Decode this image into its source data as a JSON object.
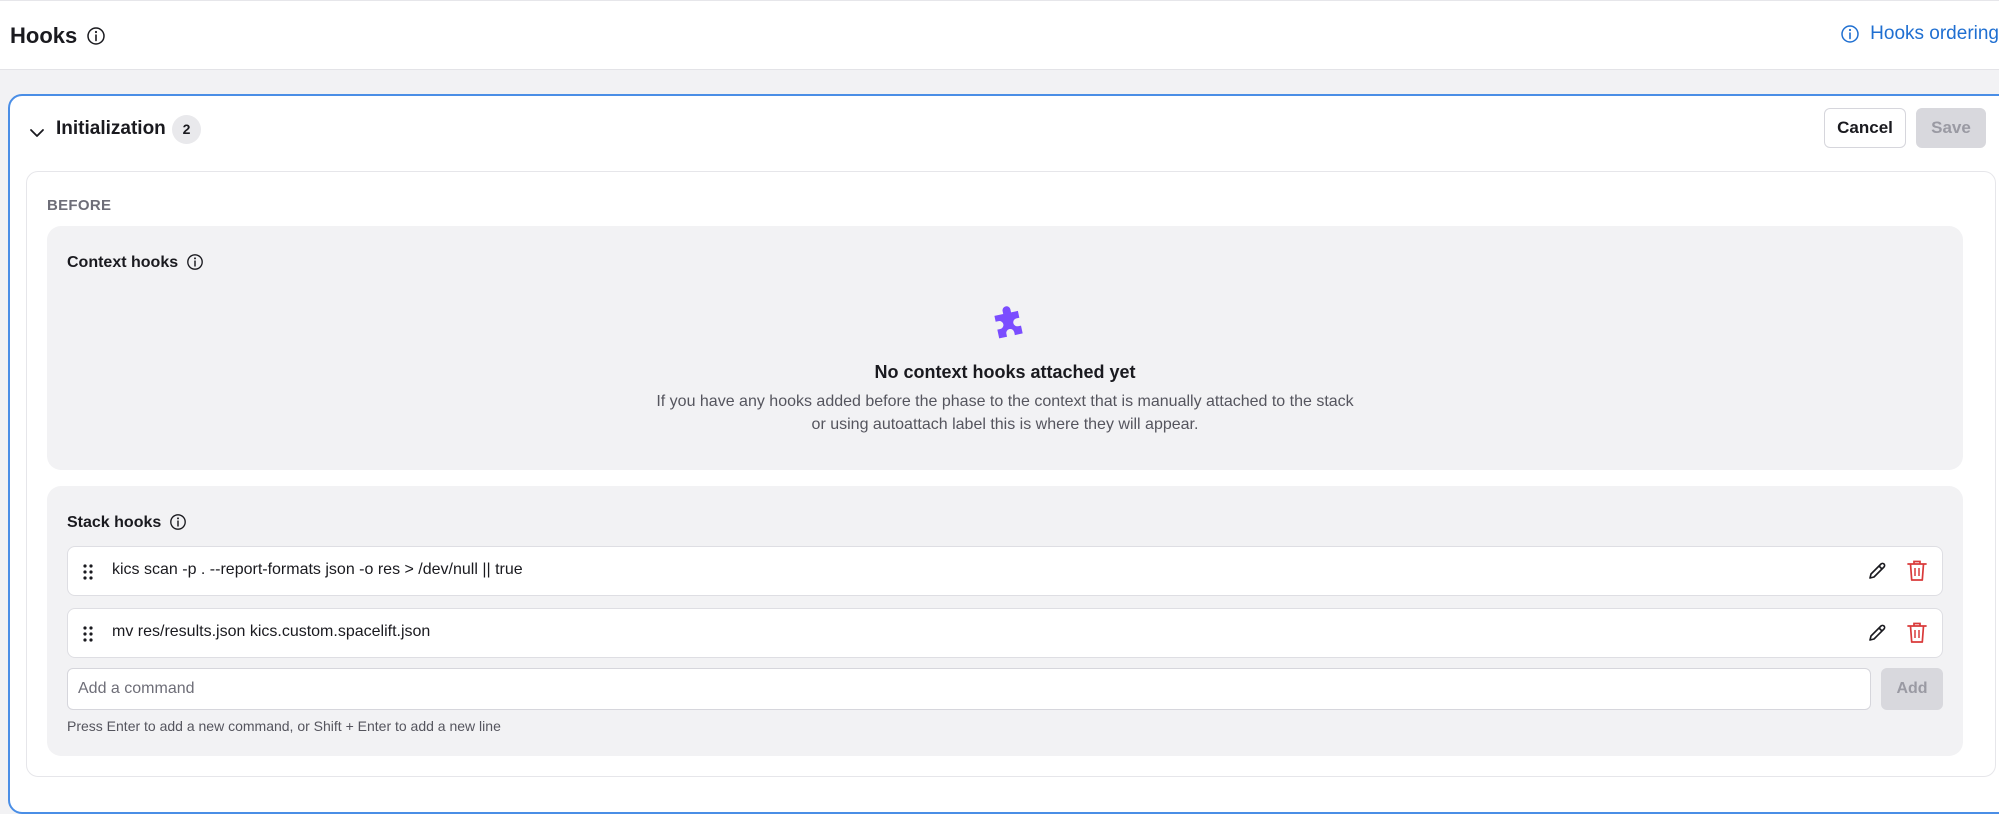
{
  "header": {
    "title": "Hooks",
    "ordering_link": "Hooks ordering"
  },
  "section": {
    "title": "Initialization",
    "count": "2",
    "cancel_label": "Cancel",
    "save_label": "Save",
    "phase": "BEFORE",
    "context_hooks": {
      "title": "Context hooks",
      "empty_title": "No context hooks attached yet",
      "empty_line1": "If you have any hooks added before the phase to the context that is manually attached to the stack",
      "empty_line2": "or using autoattach label this is where they will appear."
    },
    "stack_hooks": {
      "title": "Stack hooks",
      "items": [
        {
          "command": "kics scan -p . --report-formats json -o res > /dev/null || true"
        },
        {
          "command": "mv res/results.json kics.custom.spacelift.json"
        }
      ],
      "input_placeholder": "Add a command",
      "add_label": "Add",
      "help": "Press Enter to add a new command, or Shift + Enter to add a new line"
    }
  },
  "colors": {
    "accent": "#1f6fd1",
    "panel_border": "#4a8ee6",
    "delete": "#d93a3a",
    "puzzle": "#7b4dff"
  },
  "icons": [
    "info-icon",
    "chevron-down-icon",
    "puzzle-icon",
    "drag-handle-icon",
    "pencil-icon",
    "trash-icon"
  ]
}
